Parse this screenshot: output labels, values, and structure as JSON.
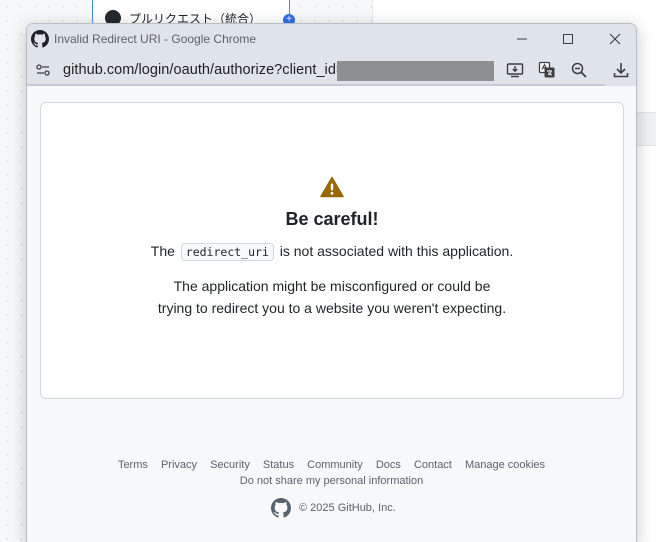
{
  "background": {
    "tab_label": "プルリクエスト（統合）"
  },
  "window": {
    "title": "Invalid Redirect URI - Google Chrome"
  },
  "address_bar": {
    "url": "github.com/login/oauth/authorize?client_id="
  },
  "page": {
    "heading": "Be careful!",
    "line1_prefix": "The",
    "line1_code": "redirect_uri",
    "line1_suffix": "is not associated with this application.",
    "para_line1": "The application might be misconfigured or could be",
    "para_line2": "trying to redirect you to a website you weren't expecting."
  },
  "footer": {
    "links": [
      "Terms",
      "Privacy",
      "Security",
      "Status",
      "Community",
      "Docs",
      "Contact",
      "Manage cookies"
    ],
    "privacy_link": "Do not share my personal information",
    "copyright": "© 2025 GitHub, Inc."
  },
  "colors": {
    "warning": "#9a6700",
    "text": "#1f2328",
    "muted": "#59636e"
  }
}
